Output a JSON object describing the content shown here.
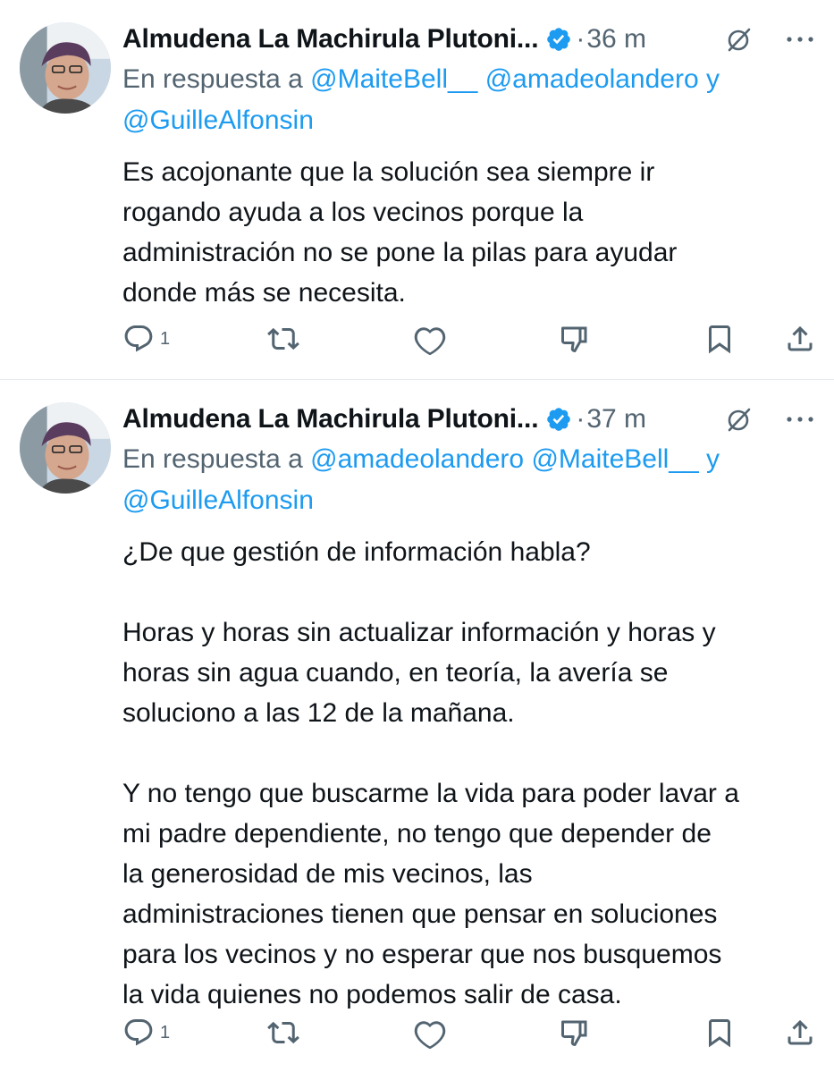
{
  "tweets": [
    {
      "author": "Almudena La Machirula Plutoni...",
      "time": "36 m",
      "reply_prefix": "En respuesta a ",
      "mentions": [
        "@MaiteBell__",
        "@amadeolandero"
      ],
      "conjunction": "y",
      "mention_last": "@GuilleAlfonsin",
      "text": "Es acojonante que la solución sea siempre ir\nrogando ayuda a los vecinos porque la\nadministración no se pone la pilas para ayudar\ndonde más se necesita.",
      "reply_count": "1"
    },
    {
      "author": "Almudena La Machirula Plutoni...",
      "time": "37 m",
      "reply_prefix": "En respuesta a ",
      "mentions": [
        "@amadeolandero",
        "@MaiteBell__"
      ],
      "conjunction": "y",
      "mention_last": "@GuilleAlfonsin",
      "text": "¿De que gestión de información habla?\n\nHoras y horas sin actualizar información y horas y\nhoras sin agua cuando, en teoría, la avería se\nsoluciono a las 12 de la mañana.\n\nY no tengo que buscarme la vida para poder lavar a\nmi padre dependiente, no tengo que depender de\nla generosidad de mis vecinos, las\nadministraciones tienen que pensar en soluciones\npara los vecinos y no esperar que nos busquemos\nla vida quienes no podemos salir de casa.",
      "reply_count": "1"
    }
  ],
  "separator_dot": "·",
  "icons": {
    "verified": "verified-badge-icon",
    "grok": "grok-icon",
    "more": "more-dots-icon",
    "reply": "reply-bubble-icon",
    "retweet": "retweet-icon",
    "like": "heart-icon",
    "dislike": "downvote-icon",
    "bookmark": "bookmark-icon",
    "share": "share-icon"
  },
  "colors": {
    "accent": "#1d9bf0",
    "secondary_text": "#536471",
    "primary_text": "#0f1419"
  }
}
